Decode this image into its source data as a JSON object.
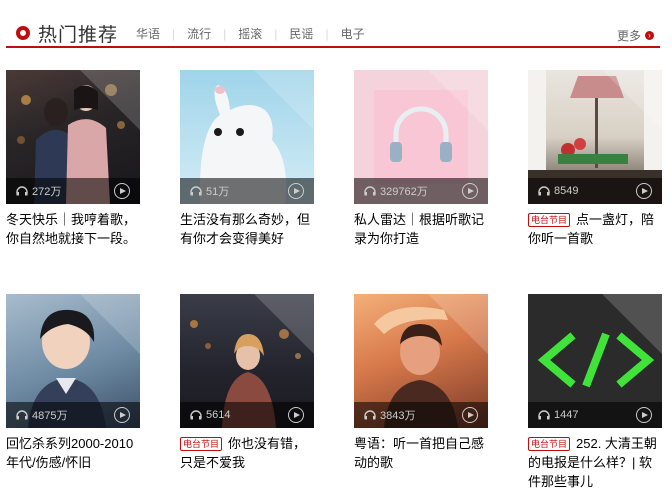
{
  "header": {
    "title": "热门推荐",
    "tabs": [
      "华语",
      "流行",
      "摇滚",
      "民谣",
      "电子"
    ],
    "more": "更多"
  },
  "playlists": [
    {
      "plays": "272万",
      "title": "冬天快乐｜我哼着歌，你自然地就接下一段。",
      "radio": false,
      "icon": "couple-photo"
    },
    {
      "plays": "51万",
      "title": "生活没有那么奇妙，但有你才会变得美好",
      "radio": false,
      "icon": "plush-toy-photo"
    },
    {
      "plays": "329762万",
      "title": "私人雷达｜根据听歌记录为你打造",
      "radio": false,
      "icon": "headphones-photo"
    },
    {
      "plays": "8549",
      "title": "点一盏灯，陪你听一首歌",
      "radio": true,
      "icon": "lamp-photo"
    },
    {
      "plays": "4875万",
      "title": "回忆杀系列2000-2010年代/伤感/怀旧",
      "radio": false,
      "icon": "singer-portrait"
    },
    {
      "plays": "5614",
      "title": "你也没有错，只是不爱我",
      "radio": true,
      "icon": "night-city-photo"
    },
    {
      "plays": "3843万",
      "title": "粤语：听一首把自己感动的歌",
      "radio": false,
      "icon": "man-portrait"
    },
    {
      "plays": "1447",
      "title": "252. 大清王朝的电报是什么样？| 软件那些事儿",
      "radio": true,
      "icon": "code-brackets-logo"
    }
  ],
  "radio_tag": "电台节目",
  "colors": {
    "accent": "#c10d0c"
  }
}
